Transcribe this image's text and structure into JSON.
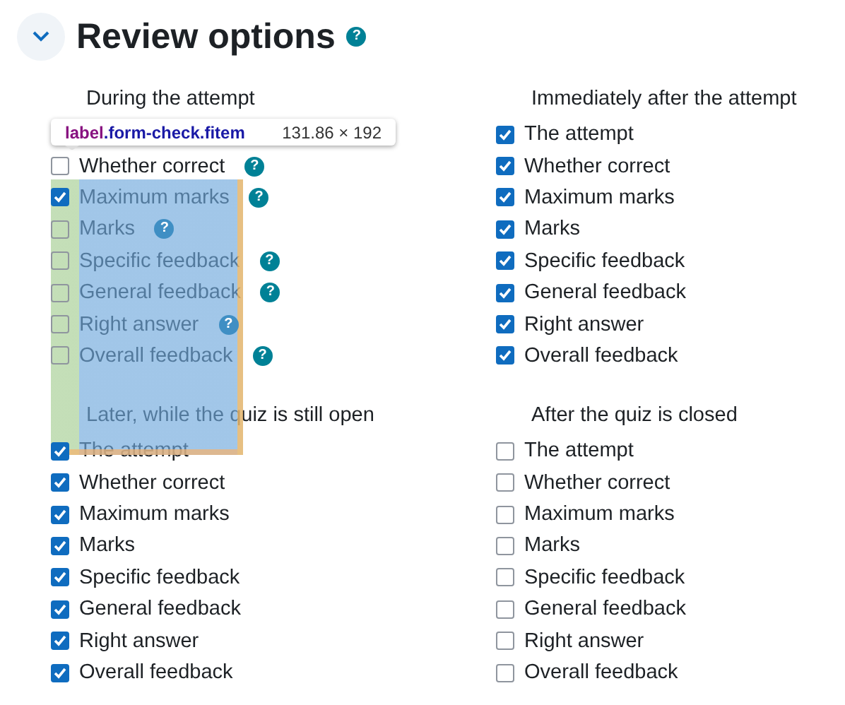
{
  "title": "Review options",
  "title_help": "?",
  "groups": [
    {
      "heading": "During the attempt",
      "options": [
        {
          "label": "Whether correct",
          "checked": false,
          "help": "?",
          "help_faded": false
        },
        {
          "label": "Maximum marks",
          "checked": true,
          "help": "?",
          "help_faded": false
        },
        {
          "label": "Marks",
          "checked": false,
          "help": "?",
          "help_faded": true
        },
        {
          "label": "Specific feedback",
          "checked": false,
          "help": "?",
          "help_faded": false
        },
        {
          "label": "General feedback",
          "checked": false,
          "help": "?",
          "help_faded": false
        },
        {
          "label": "Right answer",
          "checked": false,
          "help": "?",
          "help_faded": true
        },
        {
          "label": "Overall feedback",
          "checked": false,
          "help": "?",
          "help_faded": false
        }
      ]
    },
    {
      "heading": "Immediately after the attempt",
      "options": [
        {
          "label": "The attempt",
          "checked": true
        },
        {
          "label": "Whether correct",
          "checked": true
        },
        {
          "label": "Maximum marks",
          "checked": true
        },
        {
          "label": "Marks",
          "checked": true
        },
        {
          "label": "Specific feedback",
          "checked": true
        },
        {
          "label": "General feedback",
          "checked": true
        },
        {
          "label": "Right answer",
          "checked": true
        },
        {
          "label": "Overall feedback",
          "checked": true
        }
      ]
    },
    {
      "heading": "Later, while the quiz is still open",
      "options": [
        {
          "label": "The attempt",
          "checked": true
        },
        {
          "label": "Whether correct",
          "checked": true
        },
        {
          "label": "Maximum marks",
          "checked": true
        },
        {
          "label": "Marks",
          "checked": true
        },
        {
          "label": "Specific feedback",
          "checked": true
        },
        {
          "label": "General feedback",
          "checked": true
        },
        {
          "label": "Right answer",
          "checked": true
        },
        {
          "label": "Overall feedback",
          "checked": true
        }
      ]
    },
    {
      "heading": "After the quiz is closed",
      "options": [
        {
          "label": "The attempt",
          "checked": false
        },
        {
          "label": "Whether correct",
          "checked": false
        },
        {
          "label": "Maximum marks",
          "checked": false
        },
        {
          "label": "Marks",
          "checked": false
        },
        {
          "label": "Specific feedback",
          "checked": false
        },
        {
          "label": "General feedback",
          "checked": false
        },
        {
          "label": "Right answer",
          "checked": false
        },
        {
          "label": "Overall feedback",
          "checked": false
        }
      ]
    }
  ],
  "inspector": {
    "tag": "label",
    "selector": ".form-check.fitem",
    "size": "131.86 × 192"
  }
}
